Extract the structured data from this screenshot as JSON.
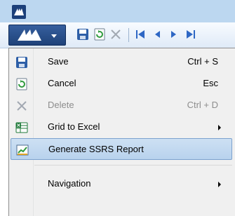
{
  "toolbar": {
    "buttons": [
      {
        "icon": "save-icon"
      },
      {
        "icon": "cancel-icon"
      },
      {
        "icon": "delete-icon"
      },
      {
        "icon": "first-record-icon"
      },
      {
        "icon": "previous-record-icon"
      },
      {
        "icon": "next-record-icon"
      },
      {
        "icon": "last-record-icon"
      }
    ]
  },
  "menu": {
    "items": [
      {
        "label": "Save",
        "shortcut": "Ctrl + S",
        "icon": "save-icon"
      },
      {
        "label": "Cancel",
        "shortcut": "Esc",
        "icon": "cancel-icon"
      },
      {
        "label": "Delete",
        "shortcut": "Ctrl + D",
        "icon": "delete-icon",
        "disabled": true
      },
      {
        "label": "Grid to Excel",
        "icon": "excel-icon",
        "submenu": true
      },
      {
        "label": "Generate SSRS Report",
        "icon": "report-icon",
        "highlighted": true
      },
      {
        "label": "Navigation",
        "submenu": true
      }
    ]
  },
  "colors": {
    "toolbar_accent": "#1f4279",
    "highlight": "#b8d2ed",
    "disabled_text": "#8d8d8d"
  }
}
